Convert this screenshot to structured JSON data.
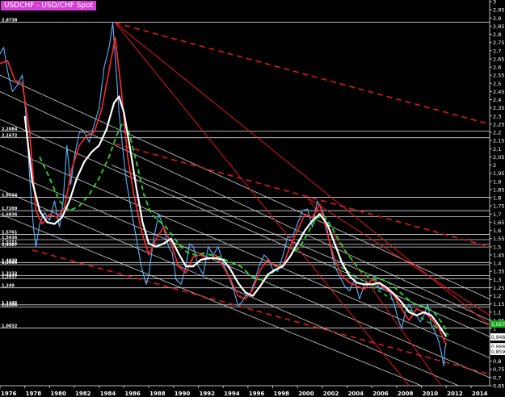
{
  "chart_data": {
    "type": "line",
    "title": "USDCHF - USD/CHF Spot",
    "ylim": [
      0.65,
      3.0
    ],
    "xlim": [
      1976.0,
      2015.5
    ],
    "y_ticks": [
      "3",
      "2,95",
      "2,9",
      "2,85",
      "2,8",
      "2,75",
      "2,7",
      "2,65",
      "2,6",
      "2,55",
      "2,5",
      "2,45",
      "2,4",
      "2,35",
      "2,3",
      "2,25",
      "2,2",
      "2,15",
      "2,1",
      "2,05",
      "2",
      "1,95",
      "1,9",
      "1,85",
      "1,8",
      "1,75",
      "1,7",
      "1,65",
      "1,6",
      "1,55",
      "1,5",
      "1,45",
      "1,4",
      "1,35",
      "1,3",
      "1,25",
      "1,2",
      "1,15",
      "1,1",
      "1,05",
      "1",
      "0,95",
      "0,9",
      "0,85",
      "0,8",
      "0,75",
      "0,7",
      "0,65"
    ],
    "x_ticks": [
      "1976",
      "1978",
      "1980",
      "1982",
      "1984",
      "1986",
      "1988",
      "1990",
      "1992",
      "1994",
      "1996",
      "1998",
      "2000",
      "2002",
      "2004",
      "2006",
      "2008",
      "2010",
      "2012",
      "2014"
    ],
    "x_tick_positions": [
      1976,
      1978,
      1980,
      1982,
      1984,
      1986,
      1988,
      1990,
      1992,
      1994,
      1996,
      1998,
      2000,
      2002,
      2004,
      2006,
      2008,
      2010,
      2012,
      2014
    ],
    "horizontal_levels": [
      {
        "label": "2,8738",
        "value": 2.8738
      },
      {
        "label": "2,2084",
        "value": 2.2084
      },
      {
        "label": "2,1672",
        "value": 2.1672
      },
      {
        "label": "1,8024",
        "value": 1.8024
      },
      {
        "label": "1,7209",
        "value": 1.7209
      },
      {
        "label": "1,6836",
        "value": 1.6836
      },
      {
        "label": "1,5761",
        "value": 1.5761
      },
      {
        "label": "1,5436",
        "value": 1.5436
      },
      {
        "label": "1,5151",
        "value": 1.5151
      },
      {
        "label": "1,4987",
        "value": 1.4987
      },
      {
        "label": "1,4039",
        "value": 1.4039
      },
      {
        "label": "1,3906",
        "value": 1.3906
      },
      {
        "label": "1,3232",
        "value": 1.3232
      },
      {
        "label": "1,3037",
        "value": 1.3037
      },
      {
        "label": "1,249",
        "value": 1.249
      },
      {
        "label": "1,1445",
        "value": 1.1445
      },
      {
        "label": "1,1306",
        "value": 1.1306
      },
      {
        "label": "1,0032",
        "value": 1.0032
      }
    ],
    "price_boxes": [
      {
        "label": "1,0272",
        "value": 1.0272,
        "color": "#1aaa1a"
      },
      {
        "label": "0,9484",
        "value": 0.9484,
        "color": "#ffffff"
      },
      {
        "label": "0,8886",
        "value": 0.8886,
        "color": "#ffffff"
      },
      {
        "label": "0,8599",
        "value": 0.8599,
        "color": "#ffffff"
      }
    ],
    "series": [
      {
        "style": "price",
        "color": "#58b4ff",
        "x": [
          1976.0,
          1976.3,
          1976.6,
          1977.0,
          1977.4,
          1977.8,
          1978.1,
          1978.4,
          1978.7,
          1978.9,
          1979.2,
          1979.6,
          1980.0,
          1980.4,
          1980.8,
          1981.1,
          1981.4,
          1981.7,
          1982.0,
          1982.4,
          1982.8,
          1983.2,
          1983.6,
          1984.0,
          1984.4,
          1984.8,
          1985.1,
          1985.3,
          1985.6,
          1985.9,
          1986.2,
          1986.6,
          1987.0,
          1987.4,
          1987.8,
          1988.0,
          1988.4,
          1988.8,
          1989.2,
          1989.6,
          1989.9,
          1990.2,
          1990.6,
          1991.0,
          1991.3,
          1991.6,
          1992.0,
          1992.4,
          1992.8,
          1993.2,
          1993.6,
          1994.0,
          1994.4,
          1994.8,
          1995.2,
          1995.5,
          1995.8,
          1996.1,
          1996.5,
          1996.9,
          1997.3,
          1997.7,
          1998.0,
          1998.4,
          1998.8,
          1999.2,
          1999.6,
          2000.0,
          2000.4,
          2000.8,
          2001.2,
          2001.6,
          2001.9,
          2002.2,
          2002.6,
          2003.0,
          2003.4,
          2003.8,
          2004.2,
          2004.6,
          2005.0,
          2005.4,
          2005.8,
          2006.2,
          2006.6,
          2007.0,
          2007.4,
          2007.8,
          2008.1,
          2008.4,
          2008.7,
          2009.0,
          2009.3,
          2009.6,
          2009.9,
          2010.2,
          2010.5,
          2010.8,
          2011.1,
          2011.4,
          2011.6,
          2011.8,
          2011.9,
          2012.0
        ],
        "values": [
          2.68,
          2.72,
          2.58,
          2.45,
          2.49,
          2.55,
          2.3,
          1.92,
          1.62,
          1.5,
          1.64,
          1.71,
          1.66,
          1.78,
          1.62,
          1.78,
          2.12,
          1.88,
          2.05,
          2.2,
          2.2,
          2.14,
          2.25,
          2.35,
          2.6,
          2.72,
          2.87,
          2.66,
          2.32,
          2.1,
          1.9,
          1.72,
          1.55,
          1.38,
          1.27,
          1.33,
          1.55,
          1.7,
          1.62,
          1.5,
          1.46,
          1.3,
          1.27,
          1.38,
          1.52,
          1.5,
          1.38,
          1.33,
          1.5,
          1.45,
          1.5,
          1.4,
          1.33,
          1.25,
          1.14,
          1.16,
          1.2,
          1.2,
          1.28,
          1.38,
          1.45,
          1.42,
          1.36,
          1.35,
          1.44,
          1.56,
          1.56,
          1.64,
          1.72,
          1.73,
          1.62,
          1.78,
          1.74,
          1.68,
          1.52,
          1.38,
          1.32,
          1.26,
          1.23,
          1.3,
          1.18,
          1.27,
          1.28,
          1.32,
          1.24,
          1.25,
          1.23,
          1.15,
          1.06,
          1.0,
          1.1,
          1.15,
          1.1,
          1.08,
          1.04,
          1.08,
          1.15,
          1.02,
          0.98,
          0.92,
          0.85,
          0.77,
          0.88,
          0.91
        ]
      },
      {
        "style": "ma-short",
        "color": "#ff2a2a",
        "x": [
          1976.0,
          1976.6,
          1977.2,
          1977.8,
          1978.4,
          1978.9,
          1979.4,
          1980.0,
          1980.6,
          1981.2,
          1981.8,
          1982.4,
          1983.0,
          1983.6,
          1984.2,
          1984.8,
          1985.3,
          1985.8,
          1986.3,
          1986.8,
          1987.4,
          1988.0,
          1988.6,
          1989.2,
          1989.8,
          1990.4,
          1991.0,
          1991.6,
          1992.2,
          1992.8,
          1993.4,
          1994.0,
          1994.6,
          1995.2,
          1995.8,
          1996.4,
          1997.0,
          1997.6,
          1998.2,
          1998.8,
          1999.4,
          2000.0,
          2000.6,
          2001.2,
          2001.8,
          2002.4,
          2003.0,
          2003.6,
          2004.2,
          2004.8,
          2005.4,
          2006.0,
          2006.6,
          2007.2,
          2007.8,
          2008.4,
          2009.0,
          2009.6,
          2010.2,
          2010.8,
          2011.4,
          2012.0
        ],
        "values": [
          2.62,
          2.64,
          2.52,
          2.5,
          2.2,
          1.72,
          1.64,
          1.7,
          1.68,
          1.74,
          1.98,
          2.12,
          2.18,
          2.2,
          2.34,
          2.58,
          2.78,
          2.45,
          2.05,
          1.82,
          1.6,
          1.45,
          1.55,
          1.62,
          1.52,
          1.38,
          1.34,
          1.44,
          1.45,
          1.42,
          1.45,
          1.38,
          1.3,
          1.2,
          1.18,
          1.24,
          1.36,
          1.42,
          1.38,
          1.38,
          1.5,
          1.6,
          1.7,
          1.68,
          1.76,
          1.58,
          1.42,
          1.32,
          1.28,
          1.26,
          1.24,
          1.3,
          1.27,
          1.24,
          1.2,
          1.12,
          1.05,
          1.12,
          1.1,
          1.06,
          1.0,
          0.9
        ]
      },
      {
        "style": "ma-mid",
        "color": "#ffffff",
        "x": [
          1978.0,
          1978.6,
          1979.2,
          1979.8,
          1980.4,
          1981.0,
          1981.6,
          1982.2,
          1982.8,
          1983.4,
          1984.0,
          1984.6,
          1985.2,
          1985.6,
          1986.0,
          1986.5,
          1987.0,
          1987.5,
          1988.0,
          1988.6,
          1989.2,
          1989.8,
          1990.4,
          1991.0,
          1991.6,
          1992.2,
          1992.8,
          1993.4,
          1994.0,
          1994.6,
          1995.2,
          1995.8,
          1996.4,
          1997.0,
          1997.6,
          1998.2,
          1998.8,
          1999.4,
          2000.0,
          2000.6,
          2001.2,
          2001.8,
          2002.4,
          2003.0,
          2003.6,
          2004.2,
          2004.8,
          2005.4,
          2006.0,
          2006.6,
          2007.2,
          2007.8,
          2008.4,
          2009.0,
          2009.6,
          2010.2,
          2010.8,
          2011.4,
          2012.0
        ],
        "values": [
          2.3,
          1.9,
          1.72,
          1.65,
          1.64,
          1.68,
          1.78,
          1.92,
          2.02,
          2.08,
          2.12,
          2.22,
          2.38,
          2.42,
          2.32,
          2.1,
          1.86,
          1.65,
          1.52,
          1.5,
          1.52,
          1.55,
          1.46,
          1.38,
          1.38,
          1.42,
          1.43,
          1.43,
          1.42,
          1.36,
          1.28,
          1.22,
          1.2,
          1.26,
          1.33,
          1.36,
          1.38,
          1.44,
          1.52,
          1.6,
          1.66,
          1.7,
          1.64,
          1.52,
          1.4,
          1.32,
          1.28,
          1.27,
          1.27,
          1.28,
          1.25,
          1.21,
          1.16,
          1.1,
          1.08,
          1.1,
          1.08,
          1.02,
          0.95
        ]
      },
      {
        "style": "ma-long",
        "color": "#22dd22",
        "x": [
          1979.2,
          1980.0,
          1980.8,
          1981.6,
          1982.4,
          1983.2,
          1984.0,
          1984.8,
          1985.4,
          1985.9,
          1986.4,
          1987.0,
          1987.6,
          1988.2,
          1988.8,
          1989.4,
          1990.0,
          1990.6,
          1991.2,
          1991.8,
          1992.4,
          1993.0,
          1993.6,
          1994.2,
          1994.8,
          1995.4,
          1996.0,
          1996.6,
          1997.2,
          1997.8,
          1998.4,
          1999.0,
          1999.6,
          2000.2,
          2000.8,
          2001.4,
          2002.0,
          2002.6,
          2003.2,
          2003.8,
          2004.4,
          2005.0,
          2005.6,
          2006.2,
          2006.8,
          2007.4,
          2008.0,
          2008.6,
          2009.2,
          2009.8,
          2010.4,
          2011.0,
          2011.6,
          2012.0
        ],
        "values": [
          2.05,
          1.92,
          1.78,
          1.72,
          1.75,
          1.82,
          1.92,
          2.05,
          2.18,
          2.26,
          2.2,
          2.02,
          1.82,
          1.7,
          1.66,
          1.62,
          1.56,
          1.5,
          1.46,
          1.45,
          1.46,
          1.45,
          1.44,
          1.42,
          1.4,
          1.38,
          1.34,
          1.3,
          1.3,
          1.33,
          1.37,
          1.4,
          1.46,
          1.5,
          1.58,
          1.66,
          1.7,
          1.64,
          1.56,
          1.48,
          1.42,
          1.36,
          1.32,
          1.3,
          1.3,
          1.28,
          1.24,
          1.2,
          1.16,
          1.14,
          1.13,
          1.1,
          1.04,
          0.99
        ]
      }
    ],
    "trendlines": [
      {
        "style": "white-solid",
        "x1": 1976.0,
        "y1": 2.55,
        "x2": 2015.5,
        "y2": 1.18
      },
      {
        "style": "white-solid",
        "x1": 1976.0,
        "y1": 2.45,
        "x2": 2015.5,
        "y2": 1.05
      },
      {
        "style": "white-solid",
        "x1": 1976.0,
        "y1": 2.28,
        "x2": 2015.5,
        "y2": 0.95
      },
      {
        "style": "white-solid",
        "x1": 1976.0,
        "y1": 2.12,
        "x2": 2015.5,
        "y2": 0.82
      },
      {
        "style": "white-solid",
        "x1": 1976.0,
        "y1": 1.98,
        "x2": 2015.5,
        "y2": 0.7
      },
      {
        "style": "white-solid",
        "x1": 1976.0,
        "y1": 1.85,
        "x2": 2013.0,
        "y2": 0.65
      },
      {
        "style": "white-solid",
        "x1": 1976.0,
        "y1": 1.7,
        "x2": 2010.0,
        "y2": 0.65
      },
      {
        "style": "white-solid",
        "x1": 1985.0,
        "y1": 2.0,
        "x2": 2015.5,
        "y2": 1.02
      },
      {
        "style": "red-solid",
        "x1": 1985.3,
        "y1": 2.87,
        "x2": 2015.5,
        "y2": 1.02
      },
      {
        "style": "red-solid",
        "x1": 1985.3,
        "y1": 2.87,
        "x2": 2009.0,
        "y2": 0.65
      },
      {
        "style": "red-solid",
        "x1": 2000.8,
        "y1": 1.8,
        "x2": 2015.5,
        "y2": 1.08
      },
      {
        "style": "red-solid",
        "x1": 2000.8,
        "y1": 1.8,
        "x2": 2011.6,
        "y2": 0.65
      },
      {
        "style": "red-dash",
        "x1": 1985.3,
        "y1": 2.87,
        "x2": 2015.5,
        "y2": 2.25
      },
      {
        "style": "red-dash",
        "x1": 1985.3,
        "y1": 2.13,
        "x2": 2015.5,
        "y2": 1.5
      },
      {
        "style": "red-dash",
        "x1": 1978.6,
        "y1": 1.48,
        "x2": 2015.5,
        "y2": 0.72
      },
      {
        "style": "green-dash",
        "x1": 2003.0,
        "y1": 1.4,
        "x2": 2012.2,
        "y2": 0.96
      }
    ]
  }
}
